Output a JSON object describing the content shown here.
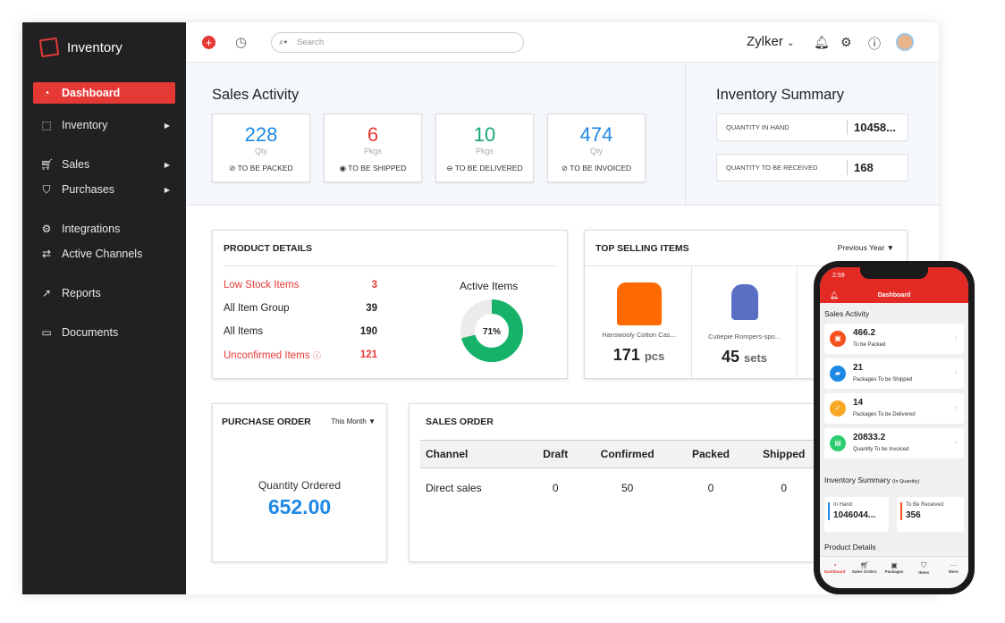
{
  "app": {
    "name": "Inventory"
  },
  "sidebar": {
    "items": [
      {
        "label": "Dashboard",
        "icon": "dashboard-icon",
        "active": true
      },
      {
        "label": "Inventory",
        "icon": "box-icon",
        "submenu": true
      },
      {
        "label": "Sales",
        "icon": "cart-icon",
        "submenu": true
      },
      {
        "label": "Purchases",
        "icon": "bag-icon",
        "submenu": true
      },
      {
        "label": "Integrations",
        "icon": "integrations-icon"
      },
      {
        "label": "Active Channels",
        "icon": "channels-icon"
      },
      {
        "label": "Reports",
        "icon": "reports-icon"
      },
      {
        "label": "Documents",
        "icon": "folder-icon"
      }
    ]
  },
  "header": {
    "search_placeholder": "Search",
    "org": "Zylker",
    "accent": "#e53935"
  },
  "sales_activity": {
    "title": "Sales Activity",
    "cards": [
      {
        "value": "228",
        "unit": "Qty",
        "label": "TO BE PACKED",
        "color": "#1e88e5"
      },
      {
        "value": "6",
        "unit": "Pkgs",
        "label": "TO BE SHIPPED",
        "color": "#e53935"
      },
      {
        "value": "10",
        "unit": "Pkgs",
        "label": "TO BE DELIVERED",
        "color": "#17a673"
      },
      {
        "value": "474",
        "unit": "Qty",
        "label": "TO BE INVOICED",
        "color": "#1e88e5"
      }
    ]
  },
  "inventory_summary": {
    "title": "Inventory Summary",
    "rows": [
      {
        "label": "QUANTITY IN HAND",
        "value": "10458..."
      },
      {
        "label": "QUANTITY TO BE RECEIVED",
        "value": "168"
      }
    ]
  },
  "product_details": {
    "title": "PRODUCT DETAILS",
    "rows": [
      {
        "label": "Low Stock Items",
        "value": "3",
        "alert": true
      },
      {
        "label": "All Item Group",
        "value": "39"
      },
      {
        "label": "All Items",
        "value": "190"
      },
      {
        "label": "Unconfirmed Items",
        "value": "121",
        "alert": true
      }
    ],
    "active_items": {
      "label": "Active Items",
      "percent": 71,
      "percent_label": "71%",
      "color": "#17b26a"
    }
  },
  "top_selling": {
    "title": "TOP SELLING ITEMS",
    "period": "Previous Year",
    "items": [
      {
        "name": "Hanswooly Cotton Cas...",
        "qty": "171",
        "unit": "pcs"
      },
      {
        "name": "Cutiepie Rompers-spo...",
        "qty": "45",
        "unit": "sets"
      }
    ]
  },
  "purchase_order": {
    "title": "PURCHASE ORDER",
    "period": "This Month",
    "label": "Quantity Ordered",
    "value": "652.00"
  },
  "sales_order": {
    "title": "SALES ORDER",
    "columns": [
      "Channel",
      "Draft",
      "Confirmed",
      "Packed",
      "Shipped"
    ],
    "rows": [
      [
        "Direct sales",
        "0",
        "50",
        "0",
        "0"
      ]
    ]
  },
  "phone": {
    "time": "2:59",
    "title": "Dashboard",
    "sales_title": "Sales Activity",
    "cards": [
      {
        "value": "466.2",
        "label": "To be Packed",
        "color": "#f4511e"
      },
      {
        "value": "21",
        "label": "Packages To be Shipped",
        "color": "#1e88e5"
      },
      {
        "value": "14",
        "label": "Packages To be Delivered",
        "color": "#f9a825"
      },
      {
        "value": "20833.2",
        "label": "Quantity To be Invoiced",
        "color": "#2ecc71"
      }
    ],
    "inv_title": "Inventory Summary",
    "inv_sub": "(In Quantity)",
    "in_hand_label": "In Hand",
    "in_hand": "1046044...",
    "to_receive_label": "To Be Received",
    "to_receive": "356",
    "product_title": "Product Details",
    "tabs": [
      "Dashboard",
      "Sales Orders",
      "Packages",
      "Items",
      "More"
    ]
  }
}
